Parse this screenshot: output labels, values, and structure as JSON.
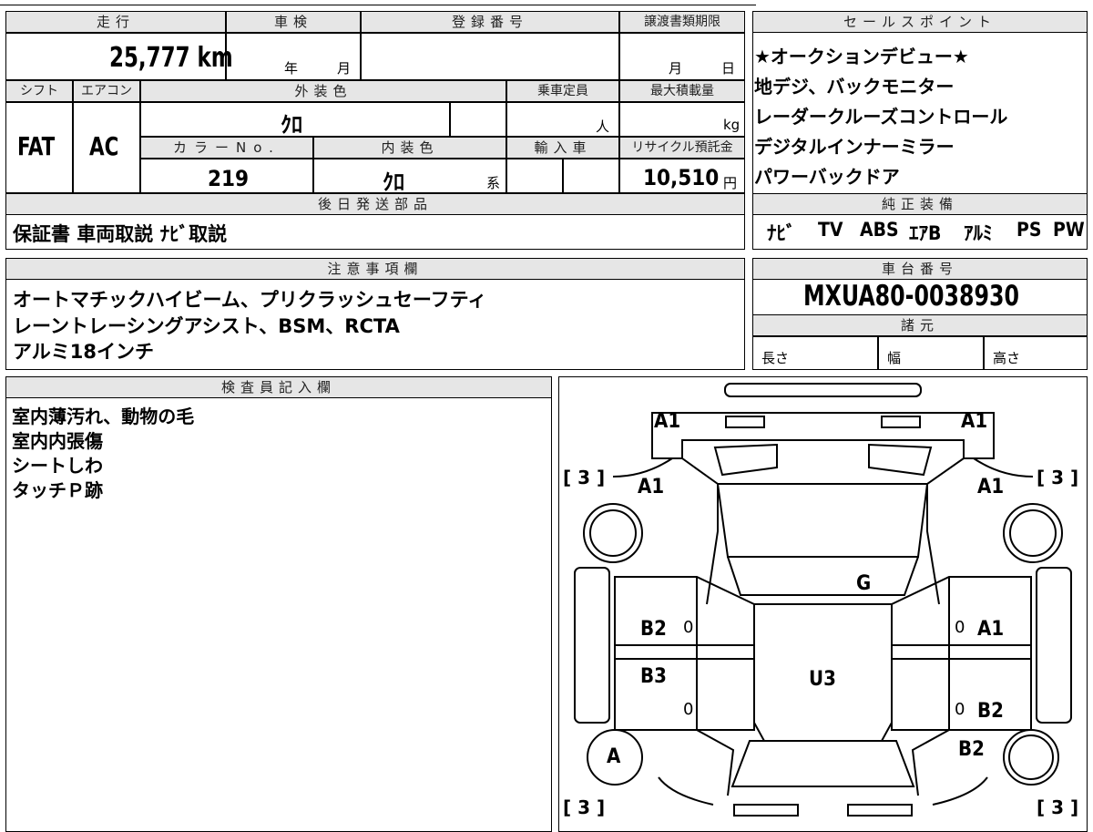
{
  "top": {
    "mileage_header": "走行",
    "inspection_header": "車検",
    "registration_header": "登録番号",
    "transfer_header": "譲渡書類期限",
    "mileage_value": "25,777 km",
    "inspection_year": "年",
    "inspection_month": "月",
    "transfer_month": "月",
    "transfer_day": "日",
    "shift_header": "シフト",
    "ac_header": "エアコン",
    "exterior_header": "外装色",
    "capacity_header": "乗車定員",
    "load_header": "最大積載量",
    "shift_value": "FAT",
    "ac_value": "AC",
    "exterior_value": "ｸﾛ",
    "capacity_unit": "人",
    "load_unit": "kg",
    "color_no_header": "カラーNo.",
    "interior_header": "内装色",
    "import_header": "輸入車",
    "recycle_header": "リサイクル預託金",
    "color_no_value": "219",
    "interior_value": "ｸﾛ",
    "interior_suffix": "系",
    "recycle_value": "10,510",
    "recycle_unit": "円",
    "later_parts_header": "後日発送部品",
    "later_parts_value": "保証書 車両取説 ﾅﾋﾞ取説"
  },
  "sales": {
    "header": "セールスポイント",
    "lines": [
      "★オークションデビュー★",
      "地デジ、バックモニター",
      "レーダークルーズコントロール",
      "デジタルインナーミラー",
      "パワーバックドア"
    ],
    "equipment_header": "純正装備",
    "equipment": [
      "ﾅﾋﾞ",
      "TV",
      "ABS",
      "ｴｱB",
      "ｱﾙﾐ",
      "PS",
      "PW"
    ]
  },
  "notes": {
    "header": "注意事項欄",
    "lines": [
      "オートマチックハイビーム、プリクラッシュセーフティ",
      "レーントレーシングアシスト、BSM、RCTA",
      "アルミ18インチ"
    ]
  },
  "chassis": {
    "header": "車台番号",
    "value": "MXUA80-0038930",
    "spec_header": "諸元",
    "length": "長さ",
    "width": "幅",
    "height": "高さ"
  },
  "inspector": {
    "header": "検査員記入欄",
    "lines": [
      "室内薄汚れ、動物の毛",
      "室内内張傷",
      "シートしわ",
      "タッチＰ跡"
    ]
  },
  "diagram": {
    "labels": {
      "front_left": "A1",
      "front_right": "A1",
      "fender_left": "A1",
      "fender_right": "A1",
      "bracket_tl": "[ 3 ]",
      "bracket_tr": "[ 3 ]",
      "bracket_bl": "[ 3 ]",
      "bracket_br": "[ 3 ]",
      "windshield": "G",
      "door_fl": "B2",
      "door_fr": "A1",
      "door_rl": "B3",
      "door_rr": "B2",
      "roof": "U3",
      "wheel_rl": "A",
      "quarter_rr": "B2",
      "zero1": "0",
      "zero2": "0",
      "zero3": "0",
      "zero4": "0"
    }
  }
}
